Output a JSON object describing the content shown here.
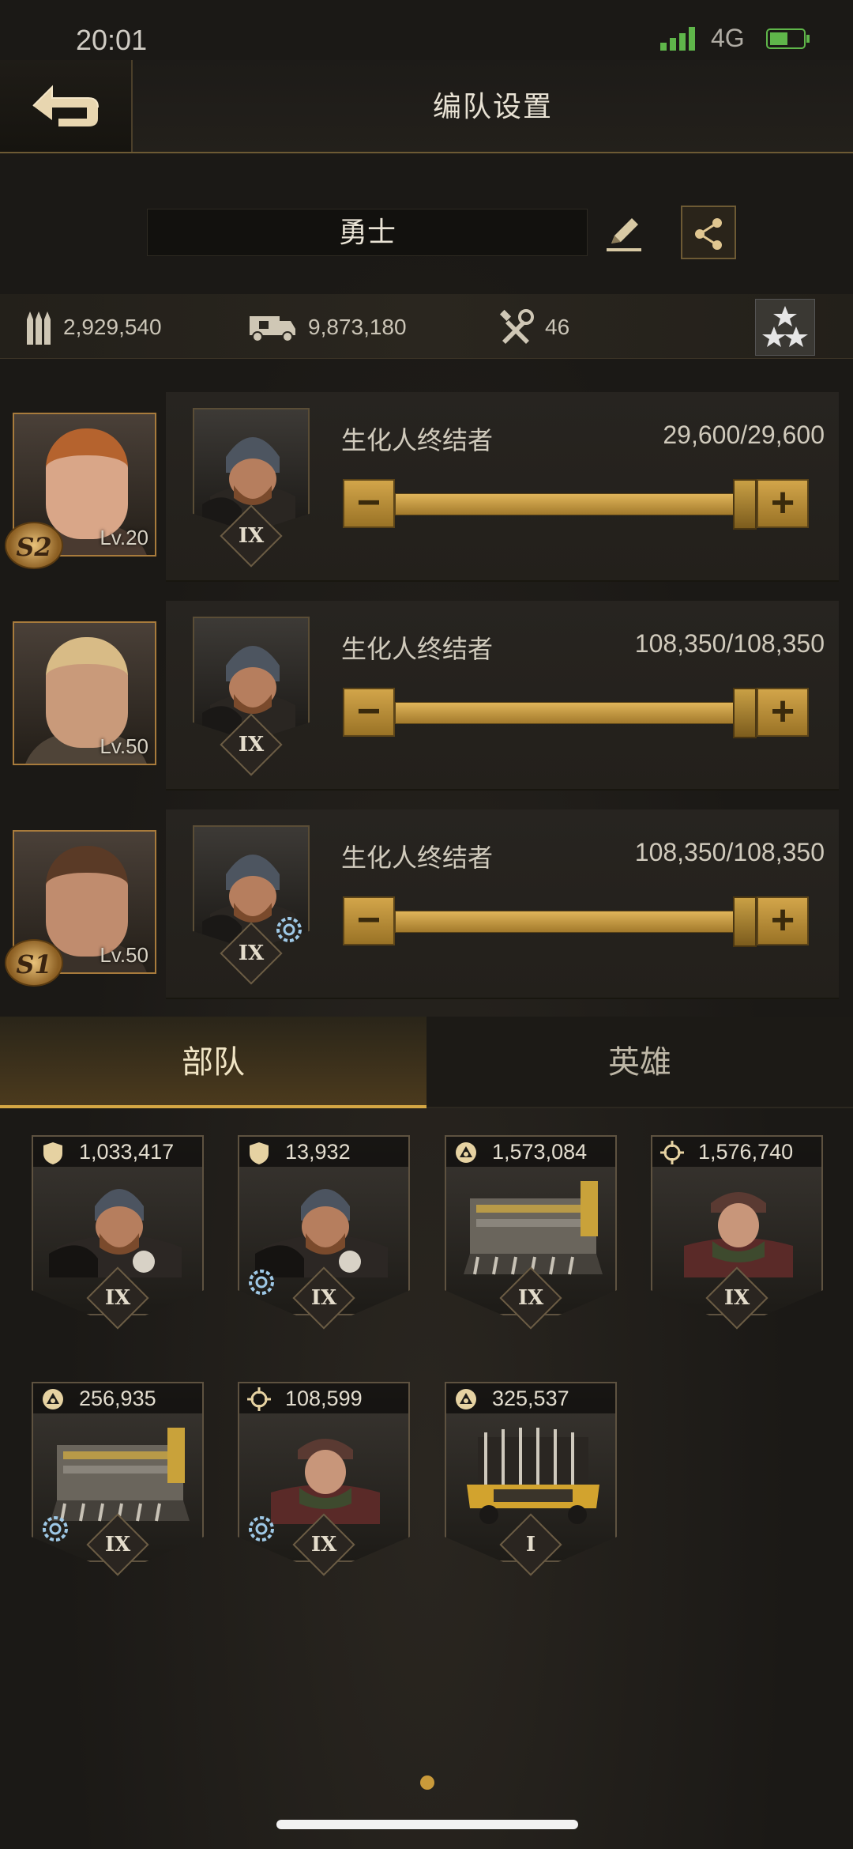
{
  "status_bar": {
    "time": "20:01",
    "network": "4G"
  },
  "header": {
    "title": "编队设置",
    "back_icon": "back-arrow-icon"
  },
  "formation": {
    "name": "勇士",
    "edit_icon": "pencil-icon",
    "share_icon": "share-icon"
  },
  "resources": {
    "ammo": "2,929,540",
    "load": "9,873,180",
    "repair": "46",
    "stars_icon": "stars-icon"
  },
  "squads": [
    {
      "hero_level": "Lv.20",
      "season": "S2",
      "troop_name": "生化人终结者",
      "troop_count": "29,600/29,600",
      "troop_tier": "IX",
      "fill": 1.0
    },
    {
      "hero_level": "Lv.50",
      "season": "",
      "troop_name": "生化人终结者",
      "troop_count": "108,350/108,350",
      "troop_tier": "IX",
      "fill": 1.0
    },
    {
      "hero_level": "Lv.50",
      "season": "S1",
      "troop_name": "生化人终结者",
      "troop_count": "108,350/108,350",
      "troop_tier": "IX",
      "fill": 1.0
    }
  ],
  "tabs": {
    "army": "部队",
    "hero": "英雄",
    "active": "army"
  },
  "units": [
    {
      "count": "1,033,417",
      "tier": "IX",
      "type_icon": "shield-icon",
      "boost": false,
      "art": "soldier"
    },
    {
      "count": "13,932",
      "tier": "IX",
      "type_icon": "shield-icon",
      "boost": true,
      "art": "soldier"
    },
    {
      "count": "1,573,084",
      "tier": "IX",
      "type_icon": "vehicle-icon",
      "boost": false,
      "art": "harvester"
    },
    {
      "count": "1,576,740",
      "tier": "IX",
      "type_icon": "crosshair-icon",
      "boost": false,
      "art": "sniper"
    },
    {
      "count": "256,935",
      "tier": "IX",
      "type_icon": "vehicle-icon",
      "boost": true,
      "art": "harvester"
    },
    {
      "count": "108,599",
      "tier": "IX",
      "type_icon": "crosshair-icon",
      "boost": true,
      "art": "sniper"
    },
    {
      "count": "325,537",
      "tier": "I",
      "type_icon": "vehicle-icon",
      "boost": false,
      "art": "truck"
    }
  ],
  "colors": {
    "accent": "#d5a744",
    "background": "#1b1916"
  }
}
